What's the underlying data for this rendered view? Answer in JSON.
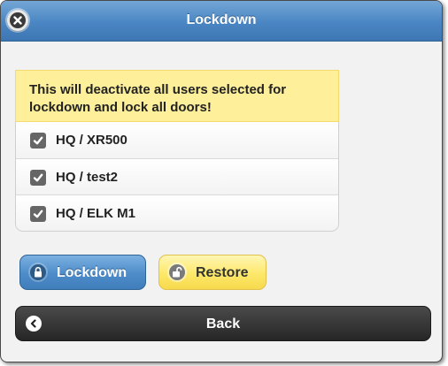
{
  "dialog": {
    "title": "Lockdown",
    "close_icon": "close-icon"
  },
  "warning": {
    "text": "This will deactivate all users selected for lockdown and lock all doors!"
  },
  "panels": {
    "items": [
      {
        "label": "HQ / XR500",
        "checked": true
      },
      {
        "label": "HQ / test2",
        "checked": true
      },
      {
        "label": "HQ / ELK M1",
        "checked": true
      }
    ]
  },
  "actions": {
    "lockdown_label": "Lockdown",
    "lockdown_icon": "lock-icon",
    "restore_label": "Restore",
    "restore_icon": "unlock-icon",
    "back_label": "Back",
    "back_icon": "chevron-left-icon"
  },
  "colors": {
    "header": "#4a86c3",
    "warning_bg": "#fef09b",
    "lockdown_button": "#4d8cc9",
    "restore_button": "#fde86a",
    "back_button": "#262626"
  }
}
